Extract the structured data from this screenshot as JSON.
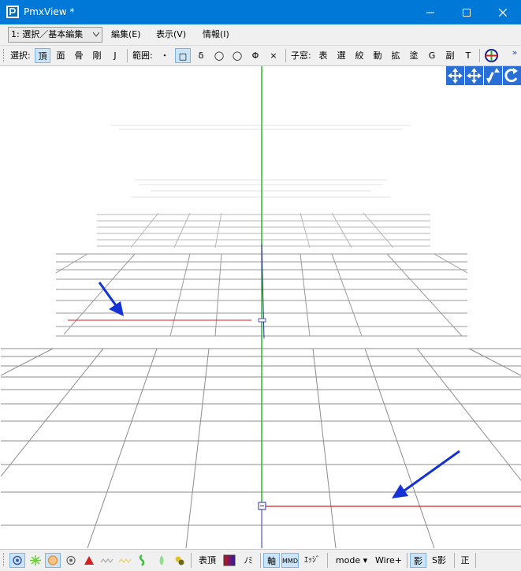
{
  "window": {
    "title": "PmxView *"
  },
  "menubar": {
    "mode_combo": "1: 選択／基本編集",
    "menus": [
      "編集(E)",
      "表示(V)",
      "情報(I)"
    ]
  },
  "toolbar": {
    "select_label": "選択:",
    "select_items": [
      "頂",
      "面",
      "骨",
      "剛",
      "J"
    ],
    "range_label": "範囲:",
    "range_items": [
      "・",
      "□",
      "δ",
      "◯",
      "△",
      "Φ",
      "×"
    ],
    "subwin_label": "子窓:",
    "subwin_items": [
      "表",
      "選",
      "絞",
      "動",
      "拡",
      "塗",
      "G",
      "副",
      "T"
    ],
    "overflow": "»"
  },
  "statusbar": {
    "vertex_label": "表頂",
    "mi_label": "ﾉﾐ",
    "axis_label": "軸",
    "mmd_label": "MMD",
    "edge_label": "ｴｯｼﾞ",
    "mode_label": "mode ▾",
    "wire_label": "Wire+",
    "shadow_label": "影",
    "sshadow_label": "S影",
    "front_label": "正"
  },
  "colors": {
    "titlebar": "#0078d7",
    "axis_green": "#1db21d",
    "axis_red": "#d42020",
    "annotation_arrow": "#1432d6"
  }
}
